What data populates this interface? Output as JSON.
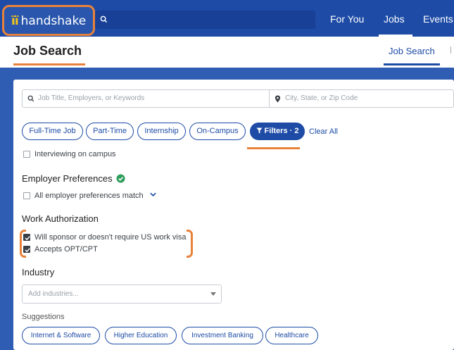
{
  "topbar": {
    "logo_text": "handshake",
    "logo_mark": "ïï",
    "nav": [
      "For You",
      "Jobs",
      "Events"
    ],
    "active_nav": "Jobs"
  },
  "page": {
    "title": "Job Search",
    "subtab": "Job Search"
  },
  "search": {
    "keywords_placeholder": "Job Title, Employers, or Keywords",
    "location_placeholder": "City, State, or Zip Code"
  },
  "chips": {
    "full_time": "Full-Time Job",
    "part_time": "Part-Time",
    "internship": "Internship",
    "on_campus": "On-Campus",
    "filters": "Filters · 2",
    "clear_all": "Clear All"
  },
  "filters": {
    "interviewing_label": "Interviewing on campus",
    "employer_prefs": {
      "title": "Employer Preferences",
      "option": "All employer preferences match"
    },
    "work_auth": {
      "title": "Work Authorization",
      "options": [
        {
          "label": "Will sponsor or doesn't require US work visa",
          "checked": true
        },
        {
          "label": "Accepts OPT/CPT",
          "checked": true
        }
      ]
    },
    "industry": {
      "title": "Industry",
      "placeholder": "Add industries...",
      "suggestions_label": "Suggestions",
      "suggestions": [
        "Internet & Software",
        "Higher Education",
        "Investment Banking",
        "Healthcare"
      ]
    }
  },
  "colors": {
    "brand_blue": "#1d4ba6",
    "highlight_orange": "#e8823a",
    "verified_green": "#2e9e5b"
  }
}
